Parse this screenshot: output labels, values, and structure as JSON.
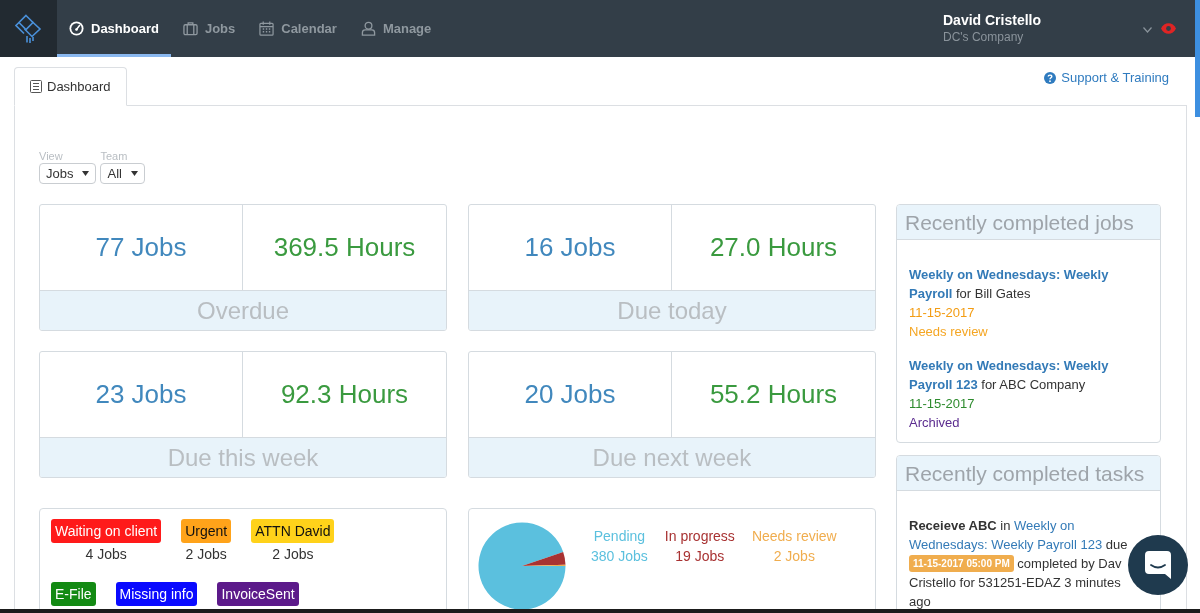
{
  "nav": {
    "tabs": [
      {
        "label": "Dashboard",
        "selected": true
      },
      {
        "label": "Jobs",
        "selected": false
      },
      {
        "label": "Calendar",
        "selected": false
      },
      {
        "label": "Manage",
        "selected": false
      }
    ],
    "user": {
      "name": "David Cristello",
      "company": "DC's Company"
    }
  },
  "page_tab": {
    "label": "Dashboard",
    "selected": true
  },
  "support_link": "Support & Training",
  "filters": [
    {
      "label": "View",
      "value": "Jobs"
    },
    {
      "label": "Team",
      "value": "All"
    }
  ],
  "stat_cards": [
    {
      "jobs": "77 Jobs",
      "hours": "369.5 Hours",
      "label": "Overdue"
    },
    {
      "jobs": "16 Jobs",
      "hours": "27.0 Hours",
      "label": "Due today"
    },
    {
      "jobs": "23 Jobs",
      "hours": "92.3 Hours",
      "label": "Due this week"
    },
    {
      "jobs": "20 Jobs",
      "hours": "55.2 Hours",
      "label": "Due next week"
    }
  ],
  "tags": [
    {
      "label": "Waiting on client",
      "color": "#ff1a1a",
      "count": "4 Jobs"
    },
    {
      "label": "Urgent",
      "color": "#ffa31a",
      "count": "2 Jobs"
    },
    {
      "label": "ATTN David",
      "color": "#ffd21a",
      "count": "2 Jobs"
    },
    {
      "label": "E-File",
      "color": "#138a13"
    },
    {
      "label": "Missing info",
      "color": "#0a0aff"
    },
    {
      "label": "InvoiceSent",
      "color": "#5c1a8a"
    }
  ],
  "status_summary": {
    "chart_data": {
      "type": "pie",
      "categories": [
        "Pending",
        "In progress",
        "Needs review"
      ],
      "values": [
        94.8,
        4.7,
        0.5
      ]
    },
    "legend": [
      {
        "count": "380 Jobs",
        "color": "#5bc0de"
      },
      {
        "count": "19 Jobs",
        "color": "#a83232"
      },
      {
        "count": "2 Jobs",
        "color": "#f0ad4e"
      }
    ]
  },
  "recent_jobs": {
    "title": "Recently completed jobs",
    "items": [
      {
        "job": "Weekly on Wednesdays: Weekly Payroll",
        "client": "for Bill Gates",
        "date": {
          "text": "11-15-2017",
          "color": "#f39c12"
        },
        "status": {
          "text": "Needs review",
          "color": "#f5a623"
        }
      },
      {
        "job": "Weekly on Wednesdays: Weekly Payroll 123",
        "client": "for ABC Company",
        "date": {
          "text": "11-15-2017",
          "color": "#2e8b2e"
        },
        "status": {
          "text": "Archived",
          "color": "#5b2c8f"
        }
      }
    ]
  },
  "recent_tasks": {
    "title": "Recently completed tasks",
    "items": [
      {
        "segments": [
          {
            "kind": "bold",
            "text": "Receieve ABC"
          },
          {
            "kind": "text",
            "text": "in"
          },
          {
            "kind": "link",
            "text": "Weekly on Wednesdays: Weekly Payroll 123"
          },
          {
            "kind": "text",
            "text": "due"
          },
          {
            "kind": "badge",
            "text": "11-15-2017 05:00 PM"
          },
          {
            "kind": "text",
            "text": "completed by Dav Cristello for 531251-EDAZ 3 minutes ago"
          }
        ]
      }
    ]
  }
}
